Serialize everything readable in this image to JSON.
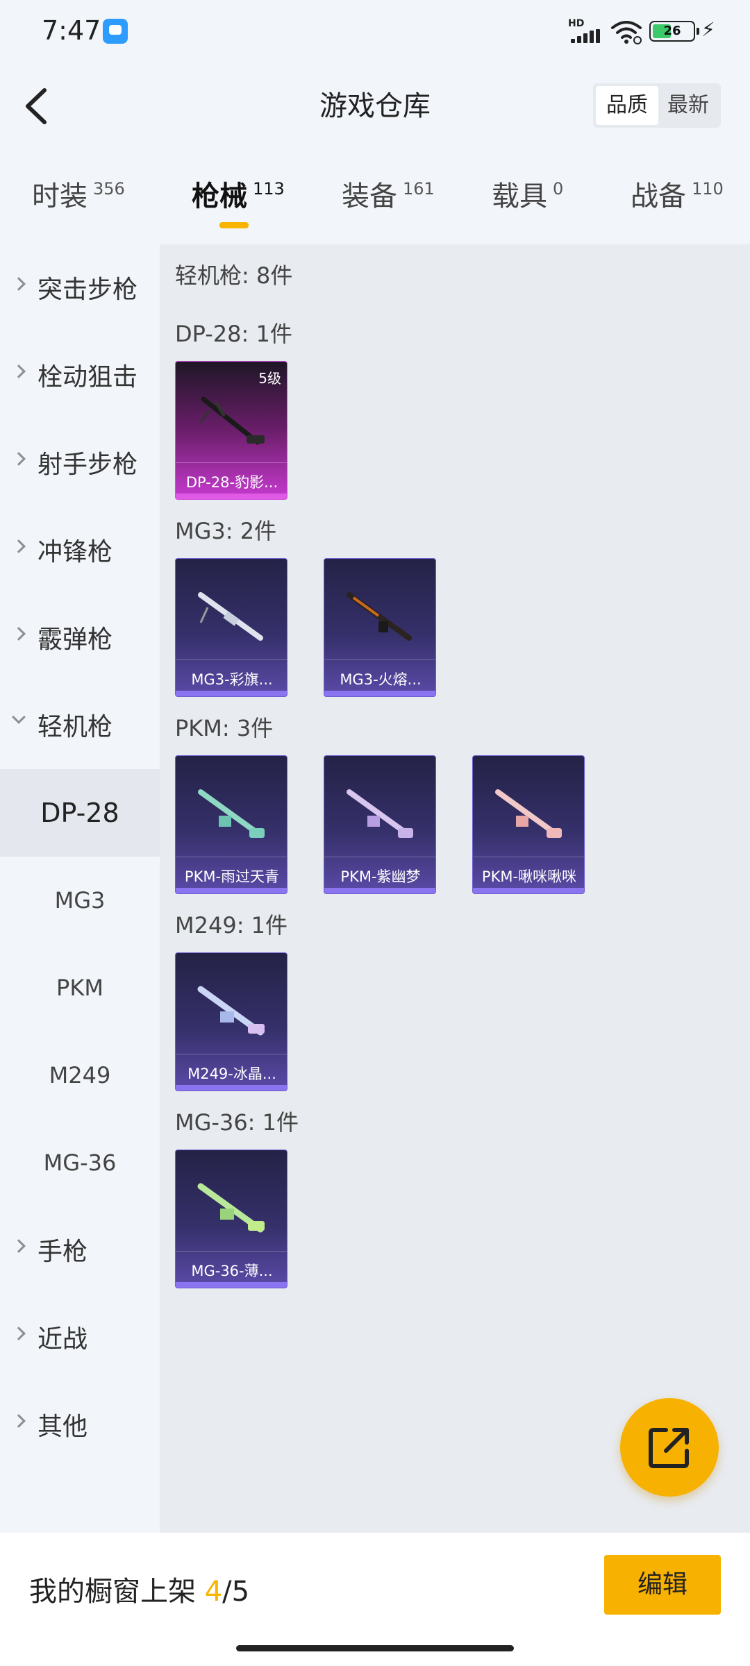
{
  "status": {
    "time": "7:47",
    "hd": "HD",
    "battery": "26"
  },
  "header": {
    "title": "游戏仓库",
    "sort_quality": "品质",
    "sort_latest": "最新"
  },
  "tabs": [
    {
      "label": "时装",
      "count": "356"
    },
    {
      "label": "枪械",
      "count": "113"
    },
    {
      "label": "装备",
      "count": "161"
    },
    {
      "label": "载具",
      "count": "0"
    },
    {
      "label": "战备",
      "count": "110"
    }
  ],
  "sidebar": {
    "items": [
      {
        "label": "突击步枪"
      },
      {
        "label": "栓动狙击"
      },
      {
        "label": "射手步枪"
      },
      {
        "label": "冲锋枪"
      },
      {
        "label": "霰弹枪"
      },
      {
        "label": "轻机枪"
      }
    ],
    "sub_items": [
      {
        "label": "DP-28"
      },
      {
        "label": "MG3"
      },
      {
        "label": "PKM"
      },
      {
        "label": "M249"
      },
      {
        "label": "MG-36"
      }
    ],
    "items_after": [
      {
        "label": "手枪"
      },
      {
        "label": "近战"
      },
      {
        "label": "其他"
      }
    ]
  },
  "content": {
    "total": "轻机枪: 8件",
    "sections": [
      {
        "heading": "DP-28: 1件",
        "cards": [
          {
            "name": "DP-28-豹影...",
            "level": "5级",
            "rarity": "pink"
          }
        ]
      },
      {
        "heading": "MG3: 2件",
        "cards": [
          {
            "name": "MG3-彩旗..."
          },
          {
            "name": "MG3-火熔..."
          }
        ]
      },
      {
        "heading": "PKM: 3件",
        "cards": [
          {
            "name": "PKM-雨过天青"
          },
          {
            "name": "PKM-紫幽梦"
          },
          {
            "name": "PKM-啾咪啾咪"
          }
        ]
      },
      {
        "heading": "M249: 1件",
        "cards": [
          {
            "name": "M249-冰晶..."
          }
        ]
      },
      {
        "heading": "MG-36: 1件",
        "cards": [
          {
            "name": "MG-36-薄..."
          }
        ]
      }
    ]
  },
  "bottom": {
    "shelf_label": "我的橱窗上架",
    "shelf_current": "4",
    "shelf_total": "/5",
    "edit_label": "编辑"
  },
  "colors": {
    "accent": "#f7b500",
    "card_purple": "#5b4aa8",
    "card_pink": "#c73ad0"
  }
}
